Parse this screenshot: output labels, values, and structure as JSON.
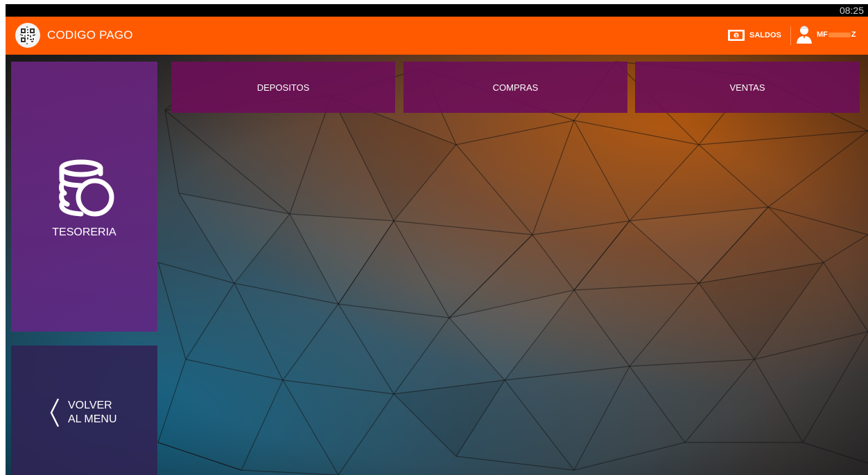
{
  "statusbar": {
    "time": "08:25"
  },
  "appbar": {
    "title": "CODIGO PAGO",
    "saldos_label": "SALDOS",
    "user": {
      "prefix": "MF",
      "suffix": "Z"
    }
  },
  "tiles": {
    "main": {
      "label": "TESORERIA",
      "icon": "coins-icon"
    },
    "back": {
      "line1": "VOLVER",
      "line2": "AL MENU",
      "icon": "chevron-left-icon"
    }
  },
  "tabs": [
    {
      "label": "DEPOSITOS"
    },
    {
      "label": "COMPRAS"
    },
    {
      "label": "VENTAS"
    }
  ],
  "colors": {
    "appbar": "#ff5a00",
    "tile_main": "#62287f",
    "tile_back": "#302454",
    "tab": "#6c0e58"
  }
}
